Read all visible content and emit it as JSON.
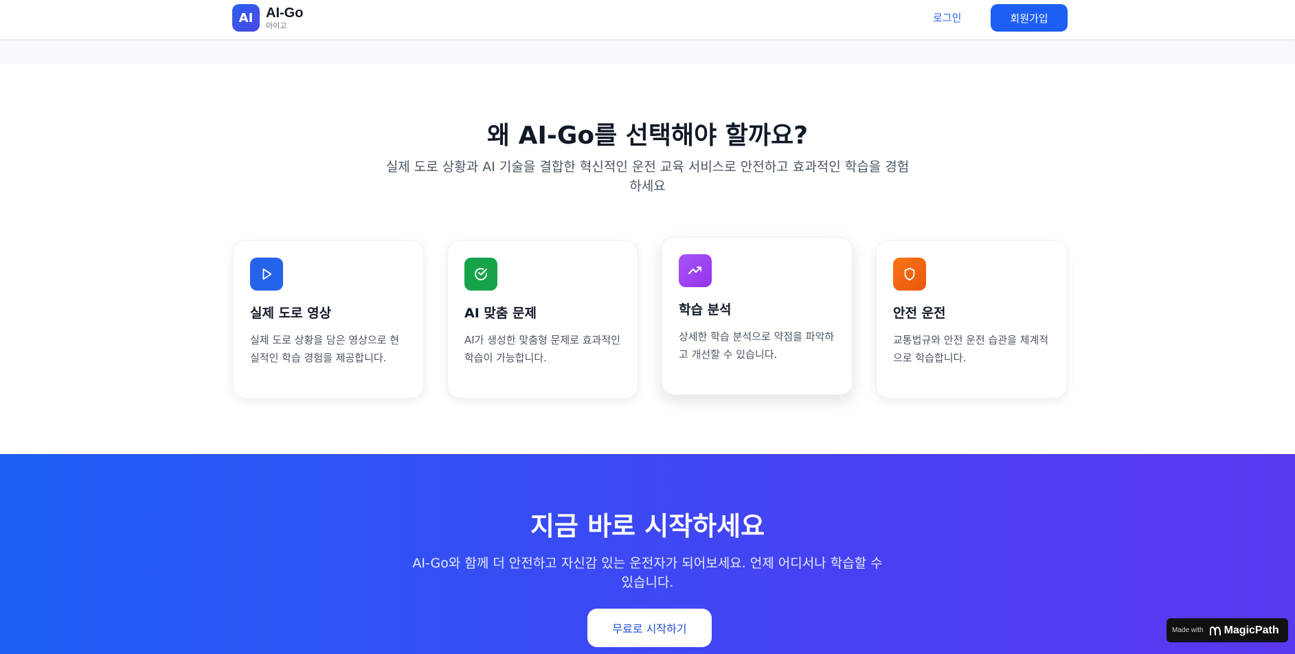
{
  "header": {
    "logo_text": "AI",
    "brand_name": "AI-Go",
    "brand_sub": "아이고",
    "login_label": "로그인",
    "signup_label": "회원가입"
  },
  "why": {
    "title": "왜 AI-Go를 선택해야 할까요?",
    "subtitle": "실제 도로 상황과 AI 기술을 결합한 혁신적인 운전 교육 서비스로 안전하고 효과적인 학습을 경험하세요"
  },
  "features": [
    {
      "icon": "play-icon",
      "color": "#2563eb",
      "title": "실제 도로 영상",
      "description": "실제 도로 상황을 담은 영상으로 현실적인 학습 경험을 제공합니다."
    },
    {
      "icon": "check-circle-icon",
      "color": "#16a34a",
      "title": "AI 맞춤 문제",
      "description": "AI가 생성한 맞춤형 문제로 효과적인 학습이 가능합니다."
    },
    {
      "icon": "trending-up-icon",
      "color": "#9333ea",
      "title": "학습 분석",
      "description": "상세한 학습 분석으로 약점을 파악하고 개선할 수 있습니다."
    },
    {
      "icon": "shield-icon",
      "color": "#ea580c",
      "title": "안전 운전",
      "description": "교통법규와 안전 운전 습관을 체계적으로 학습합니다."
    }
  ],
  "cta": {
    "title": "지금 바로 시작하세요",
    "subtitle": "AI-Go와 함께 더 안전하고 자신감 있는 운전자가 되어보세요. 언제 어디서나 학습할 수 있습니다.",
    "button_label": "무료로 시작하기"
  },
  "badge": {
    "made_with": "Made with",
    "brand": "MagicPath"
  }
}
